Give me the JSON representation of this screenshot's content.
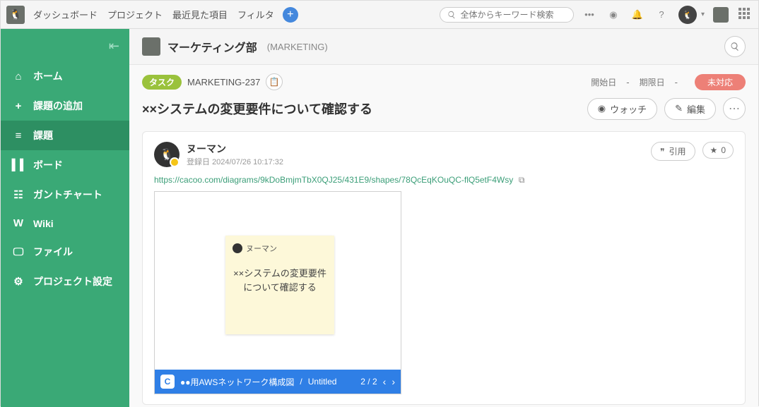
{
  "topbar": {
    "nav": [
      "ダッシュボード",
      "プロジェクト",
      "最近見た項目",
      "フィルタ"
    ],
    "search_placeholder": "全体からキーワード検索"
  },
  "sidebar": {
    "items": [
      {
        "icon": "⌂",
        "label": "ホーム"
      },
      {
        "icon": "+",
        "label": "課題の追加"
      },
      {
        "icon": "≡",
        "label": "課題"
      },
      {
        "icon": "▍▍",
        "label": "ボード"
      },
      {
        "icon": "☷",
        "label": "ガントチャート"
      },
      {
        "icon": "W",
        "label": "Wiki"
      },
      {
        "icon": "🖵",
        "label": "ファイル"
      },
      {
        "icon": "⚙",
        "label": "プロジェクト設定"
      }
    ],
    "active_index": 2
  },
  "project": {
    "name": "マーケティング部",
    "key": "(MARKETING)"
  },
  "issue": {
    "type_label": "タスク",
    "key": "MARKETING-237",
    "start_label": "開始日",
    "due_label": "期限日",
    "dash": "-",
    "status": "未対応",
    "title": "××システムの変更要件について確認する",
    "watch_label": "ウォッチ",
    "edit_label": "編集"
  },
  "comment": {
    "author": "ヌーマン",
    "date_prefix": "登録日",
    "date": "2024/07/26 10:17:32",
    "quote_label": "引用",
    "star_count": "0",
    "link": "https://cacoo.com/diagrams/9kDoBmjmTbX0QJ25/431E9/shapes/78QcEqKOuQC-flQ5etF4Wsy"
  },
  "embed": {
    "sticky_author": "ヌーマン",
    "sticky_text": "××システムの変更要件について確認する",
    "bar_icon": "C",
    "bar_title": "●●用AWSネットワーク構成図",
    "bar_sep": "/",
    "bar_sheet": "Untitled",
    "page": "2 / 2"
  }
}
